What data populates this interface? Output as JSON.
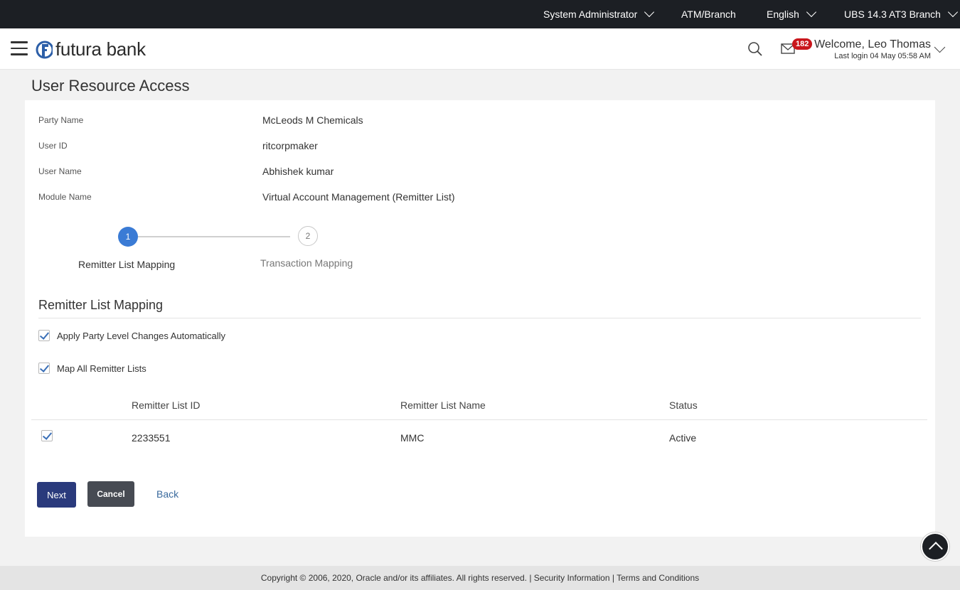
{
  "topbar": {
    "role": "System Administrator",
    "atm_branch": "ATM/Branch",
    "language": "English",
    "branch": "UBS 14.3 AT3 Branch"
  },
  "header": {
    "brand": "futura bank",
    "mail_count": "182",
    "welcome": "Welcome, Leo Thomas",
    "last_login": "Last login 04 May 05:58 AM"
  },
  "page": {
    "title": "User Resource Access"
  },
  "details": [
    {
      "label": "Party Name",
      "value": "McLeods M Chemicals"
    },
    {
      "label": "User ID",
      "value": "ritcorpmaker"
    },
    {
      "label": "User Name",
      "value": "Abhishek kumar"
    },
    {
      "label": "Module Name",
      "value": "Virtual Account Management (Remitter List)"
    }
  ],
  "stepper": [
    {
      "number": "1",
      "label": "Remitter List Mapping",
      "state": "active"
    },
    {
      "number": "2",
      "label": "Transaction Mapping",
      "state": "inactive"
    }
  ],
  "section": {
    "title": "Remitter List Mapping",
    "apply_party_level": {
      "label": "Apply Party Level Changes Automatically",
      "checked": true
    },
    "map_all": {
      "label": "Map All Remitter Lists",
      "checked": true
    }
  },
  "table": {
    "columns": [
      "Remitter List ID",
      "Remitter List Name",
      "Status"
    ],
    "rows": [
      {
        "checked": true,
        "id": "2233551",
        "name": "MMC",
        "status": "Active"
      }
    ]
  },
  "actions": {
    "next": "Next",
    "cancel": "Cancel",
    "back": "Back"
  },
  "footer": {
    "text": "Copyright © 2006, 2020, Oracle and/or its affiliates. All rights reserved. | Security Information | Terms and Conditions"
  },
  "colors": {
    "primary": "#2a3a7c",
    "step_active": "#3a7bd5",
    "badge": "#c9161c",
    "topbar": "#1c1f24"
  }
}
